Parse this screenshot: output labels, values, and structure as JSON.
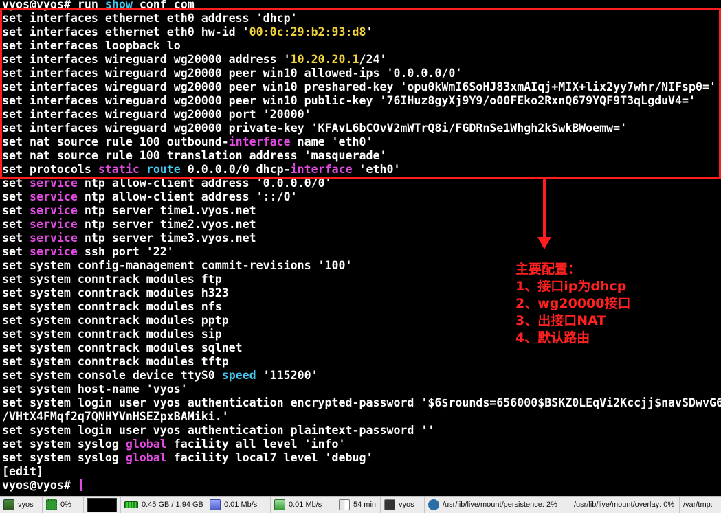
{
  "terminal": {
    "lines": [
      [
        {
          "t": "vyos@vyos# run "
        },
        {
          "t": "show",
          "c": "c"
        },
        {
          "t": " conf com"
        }
      ],
      [
        {
          "t": "set interfaces ethernet eth0 address 'dhcp'"
        }
      ],
      [
        {
          "t": "set interfaces ethernet eth0 hw-id '"
        },
        {
          "t": "00:0c:29:b2:93:d8",
          "c": "y"
        },
        {
          "t": "'"
        }
      ],
      [
        {
          "t": "set interfaces loopback lo"
        }
      ],
      [
        {
          "t": "set interfaces wireguard wg20000 address '"
        },
        {
          "t": "10.20.20.1",
          "c": "y"
        },
        {
          "t": "/24'"
        }
      ],
      [
        {
          "t": "set interfaces wireguard wg20000 peer win10 allowed-ips '0.0.0.0/0'"
        }
      ],
      [
        {
          "t": "set interfaces wireguard wg20000 peer win10 preshared-key 'opu0kWmI6SoHJ83xmAIqj+MIX+lix2yy7whr/NIFsp0='"
        }
      ],
      [
        {
          "t": "set interfaces wireguard wg20000 peer win10 public-key '76IHuz8gyXj9Y9/o00FEko2RxnQ679YQF9T3qLgduV4='"
        }
      ],
      [
        {
          "t": "set interfaces wireguard wg20000 port '20000'"
        }
      ],
      [
        {
          "t": "set interfaces wireguard wg20000 private-key 'KFAvL6bCOvV2mWTrQ8i/FGDRnSe1Whgh2kSwkBWoemw='"
        }
      ],
      [
        {
          "t": "set nat source rule 100 outbound-"
        },
        {
          "t": "interface",
          "c": "m"
        },
        {
          "t": " name 'eth0'"
        }
      ],
      [
        {
          "t": "set nat source rule 100 translation address 'masquerade'"
        }
      ],
      [
        {
          "t": "set protocols "
        },
        {
          "t": "static",
          "c": "m"
        },
        {
          "t": " "
        },
        {
          "t": "route",
          "c": "c"
        },
        {
          "t": " 0.0.0.0/0 dhcp-"
        },
        {
          "t": "interface",
          "c": "m"
        },
        {
          "t": " 'eth0'"
        }
      ],
      [
        {
          "t": "set "
        },
        {
          "t": "service",
          "c": "m"
        },
        {
          "t": " ntp allow-client address '0.0.0.0/0'"
        }
      ],
      [
        {
          "t": "set "
        },
        {
          "t": "service",
          "c": "m"
        },
        {
          "t": " ntp allow-client address '::/0'"
        }
      ],
      [
        {
          "t": "set "
        },
        {
          "t": "service",
          "c": "m"
        },
        {
          "t": " ntp server time1.vyos.net"
        }
      ],
      [
        {
          "t": "set "
        },
        {
          "t": "service",
          "c": "m"
        },
        {
          "t": " ntp server time2.vyos.net"
        }
      ],
      [
        {
          "t": "set "
        },
        {
          "t": "service",
          "c": "m"
        },
        {
          "t": " ntp server time3.vyos.net"
        }
      ],
      [
        {
          "t": "set "
        },
        {
          "t": "service",
          "c": "m"
        },
        {
          "t": " ssh port '22'"
        }
      ],
      [
        {
          "t": "set system config-management commit-revisions '100'"
        }
      ],
      [
        {
          "t": "set system conntrack modules ftp"
        }
      ],
      [
        {
          "t": "set system conntrack modules h323"
        }
      ],
      [
        {
          "t": "set system conntrack modules nfs"
        }
      ],
      [
        {
          "t": "set system conntrack modules pptp"
        }
      ],
      [
        {
          "t": "set system conntrack modules sip"
        }
      ],
      [
        {
          "t": "set system conntrack modules sqlnet"
        }
      ],
      [
        {
          "t": "set system conntrack modules tftp"
        }
      ],
      [
        {
          "t": "set system console device ttyS0 "
        },
        {
          "t": "speed",
          "c": "c"
        },
        {
          "t": " '115200'"
        }
      ],
      [
        {
          "t": "set system host-name 'vyos'"
        }
      ],
      [
        {
          "t": "set system login user vyos authentication encrypted-password '$6$rounds=656000$BSKZ0LEqVi2Kccjj$navSDwvG6"
        }
      ],
      [
        {
          "t": "/VHtX4FMqf2q7QNHYVnHSEZpxBAMiki.'"
        }
      ],
      [
        {
          "t": "set system login user vyos authentication plaintext-password ''"
        }
      ],
      [
        {
          "t": "set system syslog "
        },
        {
          "t": "global",
          "c": "m"
        },
        {
          "t": " facility all level 'info'"
        }
      ],
      [
        {
          "t": "set system syslog "
        },
        {
          "t": "global",
          "c": "m"
        },
        {
          "t": " facility local7 level 'debug'"
        }
      ],
      [
        {
          "t": "[edit]"
        }
      ],
      [
        {
          "t": "vyos@vyos# "
        }
      ]
    ]
  },
  "annotation": {
    "title": "主要配置：",
    "items": [
      "1、接口ip为dhcp",
      "2、wg20000接口",
      "3、出接口NAT",
      "4、默认路由"
    ],
    "color": "#ff2020"
  },
  "taskbar": {
    "terminal_title": "vyos",
    "cpu": "0%",
    "memory": "0.45 GB / 1.94 GB",
    "upload": "0.01 Mb/s",
    "download": "0.01 Mb/s",
    "battery": "54 min",
    "app_title": "vyos",
    "mount_persistence": "/usr/lib/live/mount/persistence: 2%",
    "mount_overlay": "/usr/lib/live/mount/overlay: 0%",
    "var_tmp": "/var/tmp:"
  },
  "colors": {
    "yellow": "#f0d33a",
    "magenta": "#e14be1",
    "cyan": "#43c8ee",
    "highlight": "#ff1e1e"
  }
}
